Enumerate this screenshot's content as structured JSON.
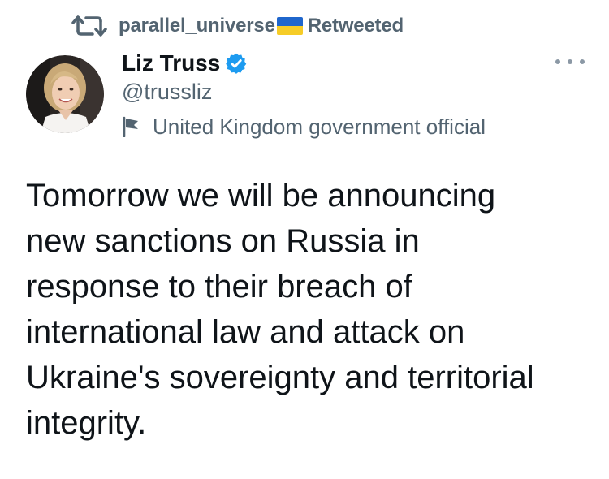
{
  "retweet": {
    "icon": "retweet-icon",
    "username": "parallel_universe",
    "flag": {
      "icon": "ukraine-flag-icon",
      "top_color": "#1f66cc",
      "bottom_color": "#f6cc27"
    },
    "label": "Retweeted"
  },
  "author": {
    "display_name": "Liz Truss",
    "verified_icon": "verified-badge-icon",
    "verified_color": "#1d9bf0",
    "handle": "@trussliz",
    "label_icon": "flag-icon",
    "label": "United Kingdom government official",
    "avatar": "avatar"
  },
  "more_icon": "more-options-icon",
  "tweet": {
    "lines": [
      "Tomorrow we will be announcing",
      "new sanctions on Russia in",
      "response to their breach of",
      "international law and attack on",
      "Ukraine's sovereignty and territorial",
      "integrity."
    ]
  },
  "colors": {
    "text_primary": "#0f1419",
    "text_secondary": "#536471"
  }
}
